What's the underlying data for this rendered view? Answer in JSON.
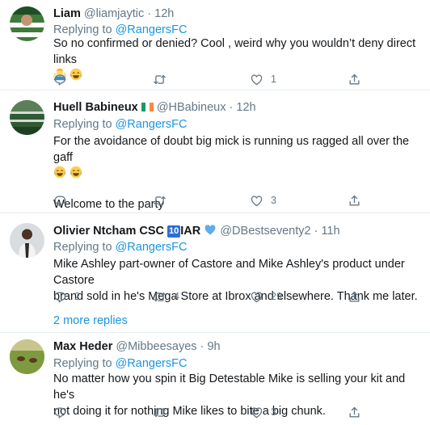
{
  "tweets": [
    {
      "name": "Liam",
      "handle": "@liamjaytic",
      "time": "12h",
      "replying_label": "Replying to",
      "replying_to": "@RangersFC",
      "text_line1": "So no confirmed or denied? Cool , weird why you wouldn’t deny direct links",
      "emojis": [
        "man-shrugging-emoji",
        "face-with-tears-of-joy-emoji"
      ],
      "replies": "",
      "retweets": "",
      "likes": "1"
    },
    {
      "name": "Huell Babineux",
      "handle": "@HBabineux",
      "time": "12h",
      "replying_label": "Replying to",
      "replying_to": "@RangersFC",
      "text_line1": "For the avoidance of doubt big mick is running us ragged all over the gaff",
      "text_line2": "Welcome to the party",
      "emojis": [
        "face-with-tears-of-joy-emoji",
        "face-with-tears-of-joy-emoji"
      ],
      "replies": "",
      "retweets": "",
      "likes": "3"
    },
    {
      "name": "Olivier Ntcham CSC",
      "name_suffix": "IAR",
      "badge_text": "10",
      "handle": "@DBestseventy2",
      "time": "11h",
      "replying_label": "Replying to",
      "replying_to": "@RangersFC",
      "text_line1": "Mike Ashley part-owner of Castore and Mike Ashley's product under Castore",
      "text_line2": "brand sold in he's Mega Store at Ibrox and elsewhere. Thank me later.",
      "replies": "2",
      "retweets": "4",
      "likes": "29",
      "more_replies": "2 more replies"
    },
    {
      "name": "Max Heder",
      "handle": "@Mibbeesayes",
      "time": "9h",
      "replying_label": "Replying to",
      "replying_to": "@RangersFC",
      "text_line1": "No matter how you spin it Big Detestable Mike is selling your kit and he's",
      "text_line2": "not doing it for nothing Mike likes to bite a big chunk.",
      "replies": "",
      "retweets": "",
      "likes": "3"
    }
  ],
  "separator": "·",
  "colors": {
    "link": "#1b95e0",
    "secondary": "#657786",
    "divider": "#e6ecf0"
  }
}
